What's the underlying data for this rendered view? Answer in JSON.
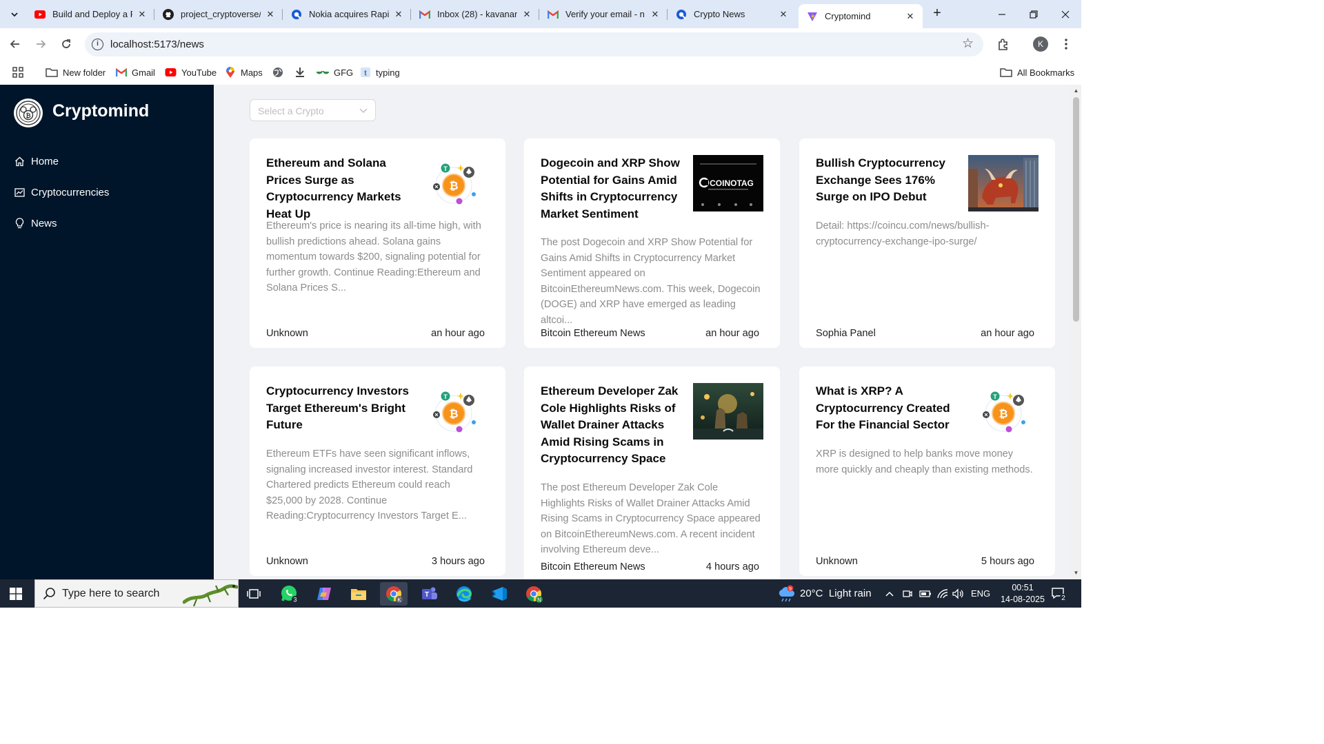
{
  "browser": {
    "tabs": [
      {
        "title": "Build and Deploy a R",
        "icon": "youtube-icon",
        "color": "#ff0000"
      },
      {
        "title": "project_cryptoverse/",
        "icon": "github-icon",
        "color": "#1f1f1f"
      },
      {
        "title": "Nokia acquires Rapid",
        "icon": "rapidapi-icon",
        "color": "#1a5bd6"
      },
      {
        "title": "Inbox (28) - kavanan",
        "icon": "gmail-icon",
        "color": "#ea4335"
      },
      {
        "title": "Verify your email - n",
        "icon": "gmail-icon",
        "color": "#ea4335"
      },
      {
        "title": "Crypto News",
        "icon": "rapidapi-icon",
        "color": "#1a5bd6"
      },
      {
        "title": "Cryptomind",
        "icon": "vite-icon",
        "color": "#8a5cf6"
      }
    ],
    "url": "localhost:5173/news",
    "profile_initial": "K",
    "bookmarks": [
      {
        "label": "New folder",
        "icon": "folder-icon"
      },
      {
        "label": "Gmail",
        "icon": "gmail-icon"
      },
      {
        "label": "YouTube",
        "icon": "youtube-icon"
      },
      {
        "label": "Maps",
        "icon": "maps-icon"
      },
      {
        "label": "",
        "icon": "globe-icon"
      },
      {
        "label": "",
        "icon": "download-icon"
      },
      {
        "label": "GFG",
        "icon": "gfg-icon"
      },
      {
        "label": "typing",
        "icon": "typing-icon"
      }
    ],
    "all_bookmarks": "All Bookmarks"
  },
  "app": {
    "brand": "Cryptomind",
    "menu": [
      {
        "label": "Home",
        "icon": "home-icon"
      },
      {
        "label": "Cryptocurrencies",
        "icon": "fund-icon"
      },
      {
        "label": "News",
        "icon": "bulb-icon"
      }
    ],
    "select_placeholder": "Select a Crypto",
    "colors": {
      "sidebar_bg": "#001529",
      "content_bg": "#f0f2f5",
      "card_bg": "#ffffff",
      "desc_text": "#8c8c8c"
    }
  },
  "news": [
    {
      "title": "Ethereum and Solana Prices Surge as Cryptocurrency Markets Heat Up",
      "description": "Ethereum's price is nearing its all-time high, with bullish predictions ahead. Solana gains momentum towards $200, signaling potential for further growth. Continue Reading:Ethereum and Solana Prices S...",
      "source": "Unknown",
      "time": "an hour ago",
      "image": "crypto-coins-image"
    },
    {
      "title": "Dogecoin and XRP Show Potential for Gains Amid Shifts in Cryptocurrency Market Sentiment",
      "description": "The post Dogecoin and XRP Show Potential for Gains Amid Shifts in Cryptocurrency Market Sentiment appeared on BitcoinEthereumNews.com. This week, Dogecoin (DOGE) and XRP have emerged as leading altcoi...",
      "source": "Bitcoin Ethereum News",
      "time": "an hour ago",
      "image": "coinotag-image",
      "image_text": "COINOTAG"
    },
    {
      "title": "Bullish Cryptocurrency Exchange Sees 176% Surge on IPO Debut",
      "description": "Detail: https://coincu.com/news/bullish-cryptocurrency-exchange-ipo-surge/",
      "source": "Sophia Panel",
      "time": "an hour ago",
      "image": "bull-image"
    },
    {
      "title": "Cryptocurrency Investors Target Ethereum's Bright Future",
      "description": "Ethereum ETFs have seen significant inflows, signaling increased investor interest. Standard Chartered predicts Ethereum could reach $25,000 by 2028. Continue Reading:Cryptocurrency Investors Target E...",
      "source": "Unknown",
      "time": "3 hours ago",
      "image": "crypto-coins-image"
    },
    {
      "title": "Ethereum Developer Zak Cole Highlights Risks of Wallet Drainer Attacks Amid Rising Scams in Cryptocurrency Space",
      "description": "The post Ethereum Developer Zak Cole Highlights Risks of Wallet Drainer Attacks Amid Rising Scams in Cryptocurrency Space appeared on BitcoinEthereumNews.com. A recent incident involving Ethereum deve...",
      "source": "Bitcoin Ethereum News",
      "time": "4 hours ago",
      "image": "fantasy-scene-image"
    },
    {
      "title": "What is XRP? A Cryptocurrency Created For the Financial Sector",
      "description": "XRP is designed to help banks move money more quickly and cheaply than existing methods.",
      "source": "Unknown",
      "time": "5 hours ago",
      "image": "crypto-coins-image"
    }
  ],
  "taskbar": {
    "search_placeholder": "Type here to search",
    "whatsapp_badge": "3",
    "weather_badge": "9",
    "weather": "20°C  Light rain",
    "language": "ENG",
    "time": "00:51",
    "date": "14-08-2025",
    "notifications": "2"
  }
}
